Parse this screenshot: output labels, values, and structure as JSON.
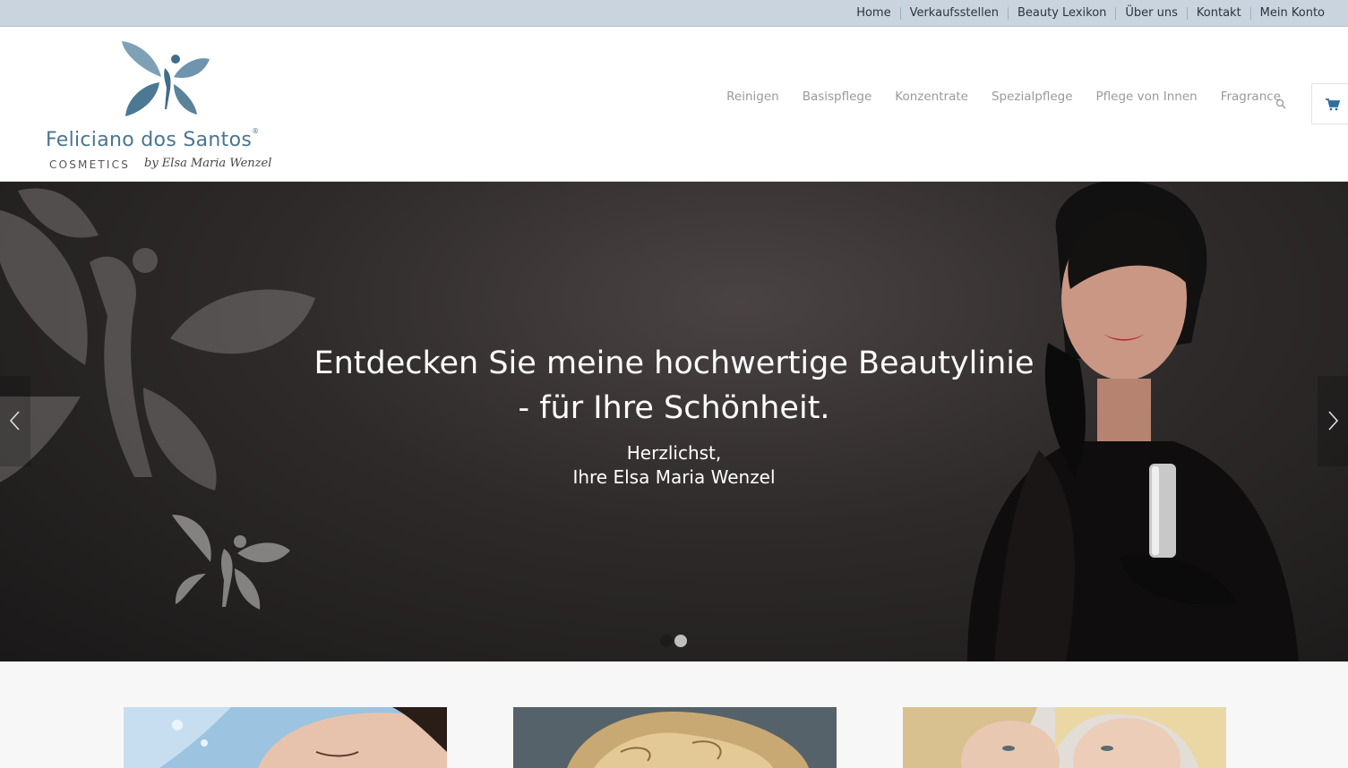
{
  "topnav": {
    "items": [
      "Home",
      "Verkaufsstellen",
      "Beauty Lexikon",
      "Über uns",
      "Kontakt",
      "Mein Konto"
    ]
  },
  "logo": {
    "brand": "Feliciano dos Santos",
    "reg": "®",
    "sub": "COSMETICS",
    "signature": "by Elsa Maria Wenzel",
    "color": "#4a7590"
  },
  "mainnav": {
    "items": [
      "Reinigen",
      "Basispflege",
      "Konzentrate",
      "Spezialpflege",
      "Pflege von Innen",
      "Fragrance"
    ],
    "search_icon": "search-icon",
    "cart_icon": "cart-icon"
  },
  "slider": {
    "title_line1": "Entdecken Sie meine hochwertige Beautylinie",
    "title_line2": "- für Ihre Schönheit.",
    "sub_line1": "Herzlichst,",
    "sub_line2": "Ihre Elsa Maria Wenzel",
    "prev_icon": "chevron-left-icon",
    "next_icon": "chevron-right-icon",
    "active_slide": 1,
    "total_slides": 2
  },
  "tiles": {
    "count": 3
  },
  "colors": {
    "accent": "#4a7590",
    "topbar": "#c9d4de",
    "cart": "#2f6f9f"
  }
}
